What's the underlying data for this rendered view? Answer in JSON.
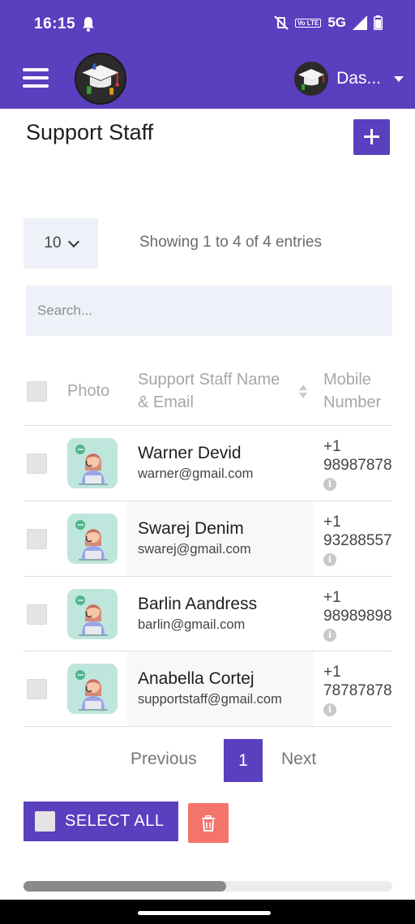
{
  "status_bar": {
    "time": "16:15",
    "network": "5G",
    "volte": "Vo LTE"
  },
  "app_bar": {
    "user_name": "Das..."
  },
  "page": {
    "title": "Support Staff"
  },
  "table_controls": {
    "page_length": "10",
    "entries_info": "Showing 1 to 4 of 4 entries",
    "search_placeholder": "Search..."
  },
  "table": {
    "headers": {
      "photo": "Photo",
      "name_line1": "Support Staff Name",
      "name_line2": "& Email",
      "mobile_line1": "Mobile",
      "mobile_line2": "Number"
    },
    "rows": [
      {
        "name": "Warner Devid",
        "email": "warner@gmail.com",
        "mobile_code": "+1",
        "mobile_number": "98987878"
      },
      {
        "name": "Swarej Denim",
        "email": "swarej@gmail.com",
        "mobile_code": "+1",
        "mobile_number": "93288557"
      },
      {
        "name": "Barlin Aandress",
        "email": "barlin@gmail.com",
        "mobile_code": "+1",
        "mobile_number": "98989898"
      },
      {
        "name": "Anabella Cortej",
        "email": "supportstaff@gmail.com",
        "mobile_code": "+1",
        "mobile_number": "78787878"
      }
    ]
  },
  "pagination": {
    "previous": "Previous",
    "current": "1",
    "next": "Next"
  },
  "bulk_actions": {
    "select_all": "SELECT ALL"
  },
  "colors": {
    "primary": "#5a3fbf",
    "danger": "#f4736a"
  }
}
